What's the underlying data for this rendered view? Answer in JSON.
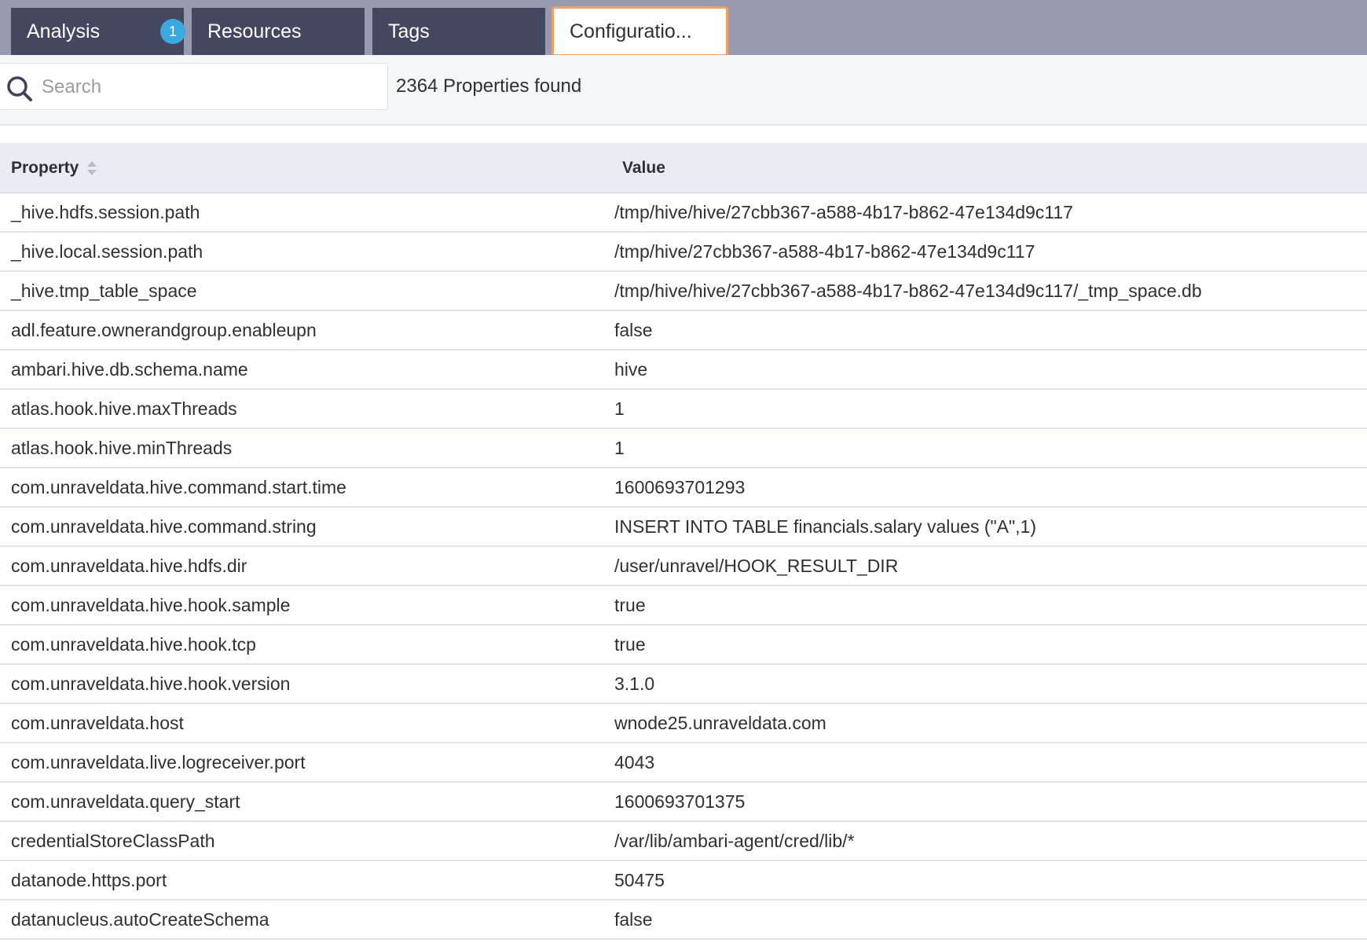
{
  "tabs": [
    {
      "label": "Analysis",
      "badge": "1"
    },
    {
      "label": "Resources"
    },
    {
      "label": "Tags"
    },
    {
      "label": "Configuratio..."
    }
  ],
  "search": {
    "placeholder": "Search",
    "value": ""
  },
  "results_count": "2364 Properties found",
  "table": {
    "headers": {
      "property": "Property",
      "value": "Value"
    },
    "rows": [
      {
        "property": "_hive.hdfs.session.path",
        "value": "/tmp/hive/hive/27cbb367-a588-4b17-b862-47e134d9c117"
      },
      {
        "property": "_hive.local.session.path",
        "value": "/tmp/hive/27cbb367-a588-4b17-b862-47e134d9c117"
      },
      {
        "property": "_hive.tmp_table_space",
        "value": "/tmp/hive/hive/27cbb367-a588-4b17-b862-47e134d9c117/_tmp_space.db"
      },
      {
        "property": "adl.feature.ownerandgroup.enableupn",
        "value": "false"
      },
      {
        "property": "ambari.hive.db.schema.name",
        "value": "hive"
      },
      {
        "property": "atlas.hook.hive.maxThreads",
        "value": "1"
      },
      {
        "property": "atlas.hook.hive.minThreads",
        "value": "1"
      },
      {
        "property": "com.unraveldata.hive.command.start.time",
        "value": "1600693701293"
      },
      {
        "property": "com.unraveldata.hive.command.string",
        "value": "INSERT INTO TABLE financials.salary values (\"A\",1)"
      },
      {
        "property": "com.unraveldata.hive.hdfs.dir",
        "value": "/user/unravel/HOOK_RESULT_DIR"
      },
      {
        "property": "com.unraveldata.hive.hook.sample",
        "value": "true"
      },
      {
        "property": "com.unraveldata.hive.hook.tcp",
        "value": "true"
      },
      {
        "property": "com.unraveldata.hive.hook.version",
        "value": "3.1.0"
      },
      {
        "property": "com.unraveldata.host",
        "value": "wnode25.unraveldata.com"
      },
      {
        "property": "com.unraveldata.live.logreceiver.port",
        "value": "4043"
      },
      {
        "property": "com.unraveldata.query_start",
        "value": "1600693701375"
      },
      {
        "property": "credentialStoreClassPath",
        "value": "/var/lib/ambari-agent/cred/lib/*"
      },
      {
        "property": "datanode.https.port",
        "value": "50475"
      },
      {
        "property": "datanucleus.autoCreateSchema",
        "value": "false"
      }
    ]
  },
  "colors": {
    "tab_bar": "#979bb0",
    "tab": "#434760",
    "active_tab_border": "#f0a063",
    "badge": "#3aa9df",
    "header_bg": "#e9edf3"
  },
  "icons": [
    "search-icon",
    "sort-icon"
  ]
}
